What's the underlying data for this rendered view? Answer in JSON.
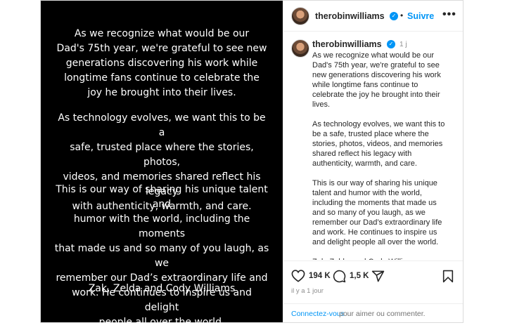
{
  "post": {
    "image_text": {
      "para1": "As we recognize what would be our\nDad's 75th year, we're grateful to see new\ngenerations discovering his work while\nlongtime fans continue to celebrate the\njoy he brought into their lives.",
      "para2": "As technology evolves, we want this to be a\nsafe, trusted place where the stories, photos,\nvideos, and memories shared reflect his legacy\nwith authenticity, warmth, and care.",
      "para3": "This is our way of sharing his unique talent and\nhumor with the world, including the moments\nthat made us and so many of you laugh, as we\nremember our Dad’s extraordinary life and\nwork. He continues to inspire us and delight\npeople all over the world.",
      "signature": "Zak, Zelda and Cody Williams"
    }
  },
  "header": {
    "username": "therobinwilliams",
    "separator": "•",
    "follow_label": "Suivre",
    "more_label": "•••"
  },
  "comment": {
    "username": "therobinwilliams",
    "time": "1 j",
    "caption": "As we recognize what would be our\nDad's 75th year, we're grateful to see\nnew generations discovering his work\nwhile longtime fans continue to\ncelebrate the joy he brought into their\nlives.\n\nAs technology evolves, we want this to\nbe a safe, trusted place where the\nstories, photos, videos, and memories\nshared reflect his legacy with\nauthenticity, warmth, and care.\n\nThis is our way of sharing his unique\ntalent and humor with the world,\nincluding the moments that made us\nand so many of you laugh, as we\nremember our Dad’s extraordinary life\nand work. He continues to inspire us\nand delight people all over the world.\n\nZak, Zelda, and Cody Williams"
  },
  "actions": {
    "likes": "194 K",
    "comments": "1,5 K",
    "posted_ago": "il y a 1 jour",
    "icons": [
      "heart-icon",
      "comment-icon",
      "share-icon",
      "bookmark-icon"
    ]
  },
  "login": {
    "link": "Connectez-vous",
    "rest": "pour aimer ou commenter."
  },
  "colors": {
    "accent": "#0095f6",
    "media_bg": "#000000",
    "muted": "#8e8e8e"
  }
}
